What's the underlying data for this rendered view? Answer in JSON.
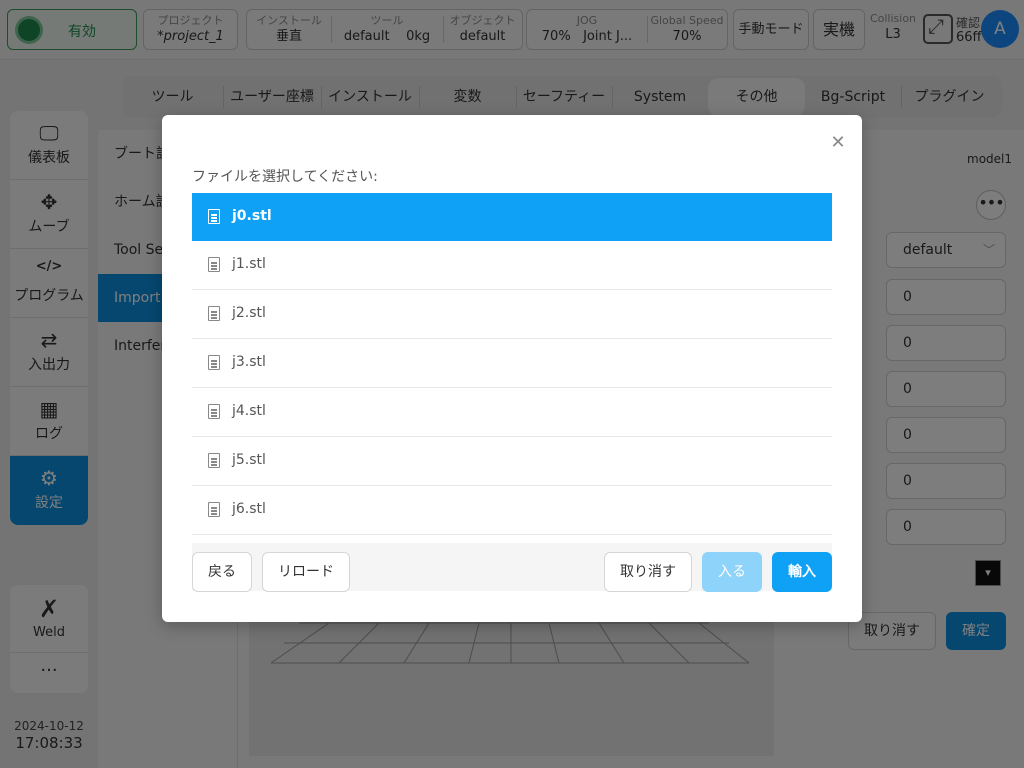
{
  "topbar": {
    "enable_label": "有効",
    "project": {
      "label": "プロジェクト",
      "value": "*project_1"
    },
    "install": {
      "label": "インストール",
      "value": "垂直"
    },
    "tool": {
      "label": "ツール",
      "value1": "default",
      "value2": "0kg"
    },
    "object": {
      "label": "オブジェクト",
      "value": "default"
    },
    "jog": {
      "label": "JOG",
      "value": "70%",
      "value2": "Joint J..."
    },
    "speed": {
      "label": "Global Speed",
      "value": "70%"
    },
    "manual_mode": "手動モード",
    "real_machine": "実機",
    "collision": {
      "label": "Collision",
      "value": "L3"
    },
    "confirm": {
      "label": "確認",
      "value": "66ff"
    },
    "avatar": "A",
    "colors": {
      "enable": "#1e8a4d",
      "accent": "#0d8ee0"
    }
  },
  "sidebar": {
    "items": [
      {
        "label": "儀表板",
        "icon": "monitor-icon"
      },
      {
        "label": "ムーブ",
        "icon": "move-icon"
      },
      {
        "label": "プログラム",
        "icon": "code-icon"
      },
      {
        "label": "入出力",
        "icon": "io-icon"
      },
      {
        "label": "ログ",
        "icon": "calendar-icon"
      },
      {
        "label": "設定",
        "icon": "gear-icon"
      }
    ],
    "weld": "Weld",
    "more": "···",
    "date": "2024-10-12",
    "time": "17:08:33"
  },
  "tabs": [
    "ツール",
    "ユーザー座標",
    "インストール",
    "変数",
    "セーフティー",
    "System Event",
    "その他",
    "Bg-Script",
    "プラグイン"
  ],
  "subnav": [
    "ブート設定",
    "ホーム設定",
    "Tool Setting",
    "Import Model",
    "Interference"
  ],
  "right_panel": {
    "model_name": "model1",
    "select_value": "default",
    "fields": [
      "0",
      "0",
      "0",
      "0",
      "0",
      "0"
    ],
    "cancel": "取り消す",
    "ok": "確定"
  },
  "dialog": {
    "title": "ファイルを選択してください:",
    "files": [
      "j0.stl",
      "j1.stl",
      "j2.stl",
      "j3.stl",
      "j4.stl",
      "j5.stl",
      "j6.stl"
    ],
    "selected_index": 0,
    "buttons": {
      "back": "戻る",
      "reload": "リロード",
      "cancel": "取り消す",
      "enter": "入る",
      "import": "輸入"
    }
  }
}
